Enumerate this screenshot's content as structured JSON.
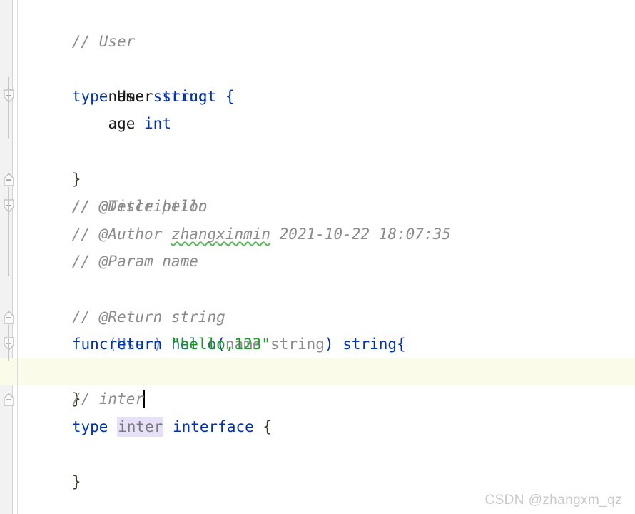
{
  "editor": {
    "language": "Go",
    "background_color": "#ffffff",
    "gutter_color": "#f2f2f2",
    "current_line_color": "#fbfbe9",
    "caret_color": "#000000",
    "identifier_highlight_color": "#e6e0f8",
    "typo_underline_color": "#5bb85b"
  },
  "colors": {
    "keyword": "#0033b3",
    "comment": "#8c8c8c",
    "string": "#1a9b28",
    "function": "#2b6e6e",
    "parameter": "#8c8c8c",
    "receiver_type": "#6b8fd6",
    "plain": "#1a1a1a"
  },
  "lines": [
    {
      "n": 1,
      "fold": "none",
      "text": "// User"
    },
    {
      "n": 2,
      "fold": "open",
      "text": "type User struct {"
    },
    {
      "n": 3,
      "fold": "none",
      "text": "    name string"
    },
    {
      "n": 4,
      "fold": "none",
      "text": "    age int"
    },
    {
      "n": 5,
      "fold": "close",
      "text": "}"
    },
    {
      "n": 6,
      "fold": "open",
      "text": "// @Title hello"
    },
    {
      "n": 7,
      "fold": "none",
      "text": "// @Description"
    },
    {
      "n": 8,
      "fold": "none",
      "text": "// @Author zhangxinmin 2021-10-22 18:07:35"
    },
    {
      "n": 9,
      "fold": "none",
      "text": "// @Param name"
    },
    {
      "n": 10,
      "fold": "close",
      "text": "// @Return string"
    },
    {
      "n": 11,
      "fold": "open",
      "text": "func(User) hello(name string) string{"
    },
    {
      "n": 12,
      "fold": "none",
      "text": "    return \"hello,123\""
    },
    {
      "n": 13,
      "fold": "close",
      "text": "}"
    },
    {
      "n": 14,
      "fold": "none",
      "text": "// inter",
      "current": true
    },
    {
      "n": 15,
      "fold": "none",
      "text": "type inter interface {"
    },
    {
      "n": 16,
      "fold": "none",
      "text": ""
    },
    {
      "n": 17,
      "fold": "none",
      "text": "}"
    }
  ],
  "tokens": {
    "comment_user": "// User",
    "kw_type": "type",
    "name_user": "User",
    "kw_struct": "struct",
    "brace_open": "{",
    "brace_close": "}",
    "field_name": "name",
    "type_string": "string",
    "field_age": "age",
    "type_int": "int",
    "doc_title": "// @Title hello",
    "doc_description": "// @Description",
    "doc_author_prefix": "// @Author ",
    "doc_author_name": "zhangxinmin",
    "doc_author_datetime": " 2021-10-22 18:07:35",
    "doc_param": "// @Param name",
    "doc_return": "// @Return string",
    "kw_func": "func",
    "receiver": "(User)",
    "func_name": "hello",
    "paren_open": "(",
    "param_name": "name ",
    "param_type": "string",
    "paren_close": ")",
    "return_type": "string",
    "kw_return": "return",
    "string_literal": "\"hello,123\"",
    "comment_inter": "// inter",
    "ident_inter": "inter",
    "kw_interface": "interface"
  },
  "watermark": {
    "text": "CSDN @zhangxm_qz"
  }
}
